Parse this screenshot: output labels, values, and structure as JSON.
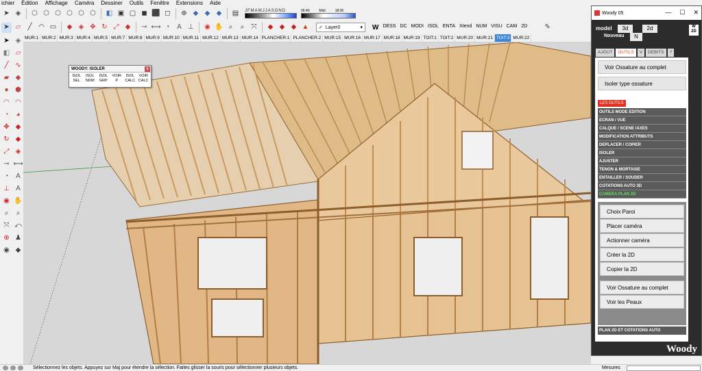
{
  "menu": [
    "ichier",
    "Édition",
    "Affichage",
    "Caméra",
    "Dessiner",
    "Outils",
    "Fenêtre",
    "Extensions",
    "Aide"
  ],
  "shadow": {
    "months": [
      "J",
      "F",
      "M",
      "A",
      "M",
      "J",
      "J",
      "A",
      "S",
      "O",
      "N",
      "D"
    ],
    "time_start": "06:40",
    "time_mid": "Midi",
    "time_end": "18:36"
  },
  "layer": "Layer0",
  "woody_toolbar": [
    "DESS",
    "DC",
    "MODI",
    "ISOL",
    "ENTA",
    "Xtend",
    "NUM",
    "VISU",
    "CAM",
    "2D"
  ],
  "tabs": [
    "MUR:1",
    "MUR:2",
    "MUR:3",
    "MUR:4",
    "MUR:5",
    "MUR:7",
    "MUR:8",
    "MUR:9",
    "MUR:10",
    "MUR:11",
    "MUR:12",
    "MUR:13",
    "MUR:14",
    "PLANCHER:1",
    "PLANCHER:2",
    "MUR:15",
    "MUR:16",
    "MUR:17",
    "MUR:18",
    "MUR:19",
    "TOIT:1",
    "TOIT:2",
    "MUR:20",
    "MUR:21",
    "TOIT:3",
    "MUR:22"
  ],
  "active_tab": "TOIT:3",
  "palette": {
    "title": "WOODY: ISOLER",
    "close": "x",
    "buttons": [
      "ISOL SEL",
      "ISOL NOM",
      "ISOL GRP",
      "VOIR P",
      "ISOL CALC",
      "VOIR CALC"
    ]
  },
  "status": {
    "message": "Sélectionnez les objets. Appuyez sur Maj pour étendre la sélection. Faites glisser la souris pour sélectionner plusieurs objets.",
    "measures_label": "Mesures"
  },
  "woody": {
    "title": "Woody 05",
    "controls": [
      "—",
      "☐",
      "✕"
    ],
    "model_label": "model",
    "btn_3d": "3d",
    "btn_2d": "2d",
    "nouveau_label": "Nouveau",
    "btn_n": "N",
    "tabs": [
      "AJOUT",
      "OUTILS",
      "V",
      "DEBITS",
      "?"
    ],
    "active_tab": "OUTILS",
    "top_buttons": [
      "Voir Ossature au complet",
      "Isoler type ossature"
    ],
    "section_label": "LES OUTILS",
    "outils": [
      "OUTILS MODE EDITION",
      "ECRAN / VUE",
      "CALQUE / SCENE /AXES",
      "MODIFICATION ATTRIBUTS",
      "DEPLACER / COPIER",
      "ISOLER",
      "AJUSTER",
      "TENON & MORTAISE",
      "ENTAILLER / SOUDER",
      "COTATIONS AUTO 3D",
      "CAMERA PLAN 2D"
    ],
    "camera_buttons": [
      "Choix Paroi",
      "Placer caméra",
      "Actionner caméra",
      "Créer la 2D",
      "Copier la 2D"
    ],
    "bottom_buttons": [
      "Voir Ossature au complet",
      "Voir les Peaux"
    ],
    "plan_label": "PLAN 2D ET COTATIONS AUTO",
    "footer": "Woody",
    "logo": "W 2D"
  },
  "colors": {
    "accent": "#3c86d8",
    "woody_red": "#e03020",
    "active_green": "#5ce35c",
    "wood": "#e9be8c"
  }
}
